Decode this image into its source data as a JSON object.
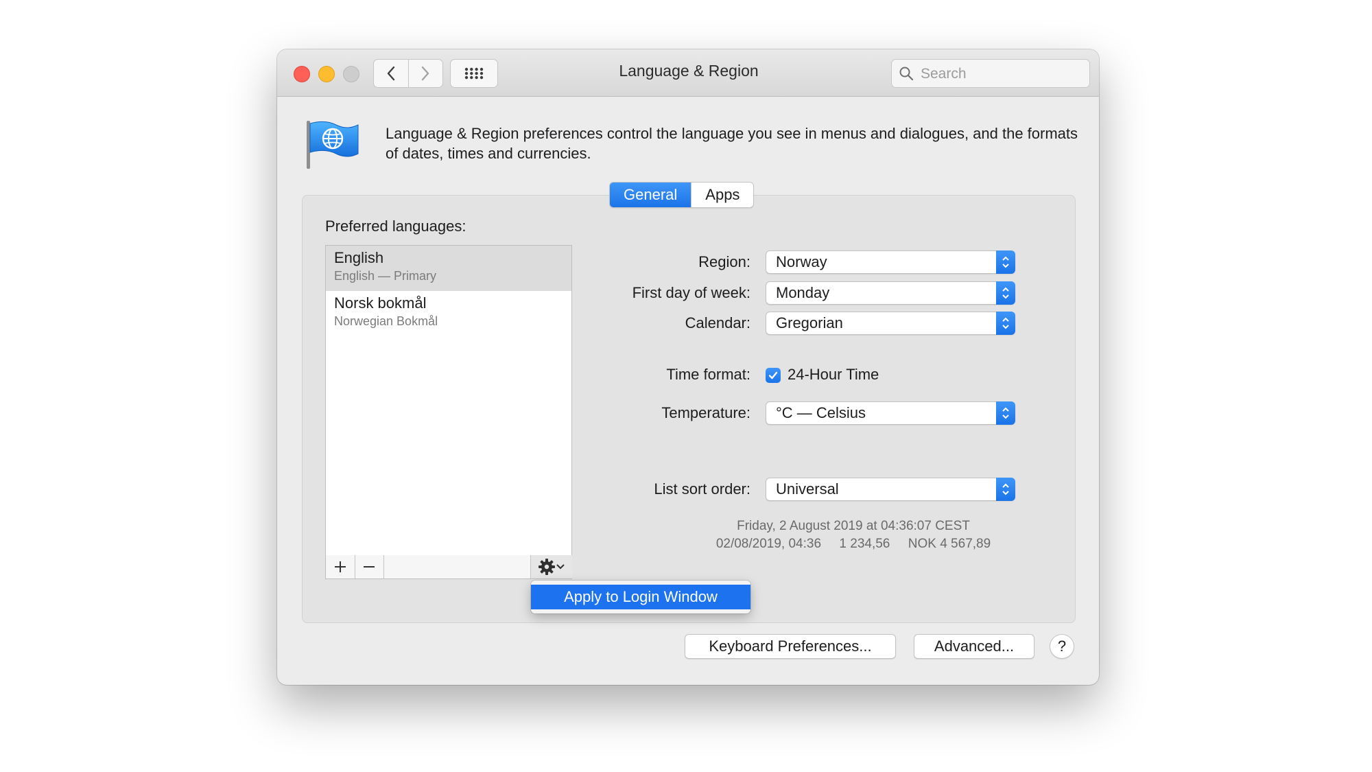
{
  "window": {
    "title": "Language & Region",
    "search_placeholder": "Search"
  },
  "description": "Language & Region preferences control the language you see in menus and dialogues, and the formats of dates, times and currencies.",
  "tabs": [
    {
      "label": "General",
      "active": true
    },
    {
      "label": "Apps",
      "active": false
    }
  ],
  "preferred_languages": {
    "label": "Preferred languages:",
    "items": [
      {
        "name": "English",
        "subtitle": "English — Primary",
        "selected": true
      },
      {
        "name": "Norsk bokmål",
        "subtitle": "Norwegian Bokmål",
        "selected": false
      }
    ],
    "add_symbol": "+",
    "remove_symbol": "—"
  },
  "context_menu": {
    "item": "Apply to Login Window"
  },
  "settings": {
    "region": {
      "label": "Region:",
      "value": "Norway"
    },
    "first_day": {
      "label": "First day of week:",
      "value": "Monday"
    },
    "calendar": {
      "label": "Calendar:",
      "value": "Gregorian"
    },
    "time_format": {
      "label": "Time format:",
      "option": "24-Hour Time",
      "checked": true
    },
    "temperature": {
      "label": "Temperature:",
      "value": "°C — Celsius"
    },
    "sort_order": {
      "label": "List sort order:",
      "value": "Universal"
    }
  },
  "sample": {
    "line1": "Friday, 2 August 2019 at 04:36:07 CEST",
    "line2": "02/08/2019, 04:36     1 234,56     NOK 4 567,89"
  },
  "buttons": {
    "keyboard": "Keyboard Preferences...",
    "advanced": "Advanced...",
    "help": "?"
  },
  "colors": {
    "accent": "#1a74e8",
    "close": "#fe5f57",
    "minimize": "#febc2e",
    "zoom_disabled": "#cdcdcd"
  }
}
